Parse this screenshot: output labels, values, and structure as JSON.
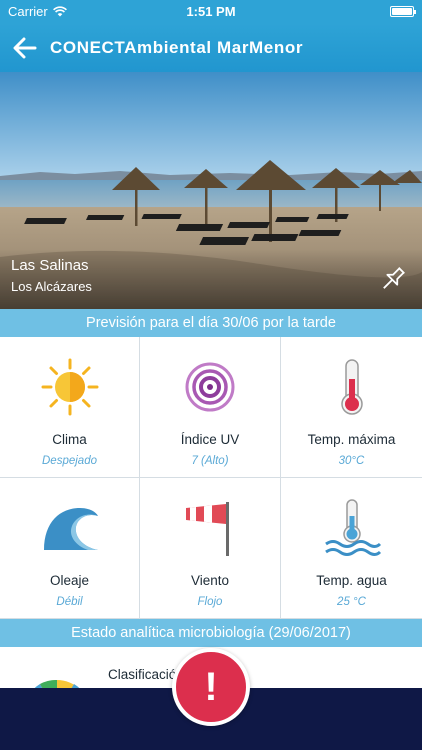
{
  "status_bar": {
    "carrier": "Carrier",
    "time": "1:51 PM"
  },
  "nav": {
    "title": "CONECTAmbiental MarMenor",
    "back_icon": "arrow-left-icon"
  },
  "hero": {
    "place_name": "Las Salinas",
    "town": "Los Alcázares",
    "pin_icon": "pin-icon"
  },
  "forecast": {
    "header": "Previsión para el día 30/06 por la tarde",
    "items": [
      {
        "label": "Clima",
        "value": "Despejado",
        "icon": "sun-icon"
      },
      {
        "label": "Índice UV",
        "value": "7 (Alto)",
        "icon": "uv-index-icon"
      },
      {
        "label": "Temp. máxima",
        "value": "30°C",
        "icon": "thermometer-icon"
      },
      {
        "label": "Oleaje",
        "value": "Débil",
        "icon": "wave-icon"
      },
      {
        "label": "Viento",
        "value": "Flojo",
        "icon": "windsock-icon"
      },
      {
        "label": "Temp. agua",
        "value": "25 °C",
        "icon": "water-thermometer-icon"
      }
    ]
  },
  "microbiology": {
    "header": "Estado analítica microbiología (29/06/2017)",
    "classification_label": "Clasificación",
    "icon": "beach-umbrella-icon"
  },
  "alert": {
    "label": "!",
    "icon": "alert-icon"
  },
  "colors": {
    "accent": "#2ea3d6",
    "band": "#6fc0e4",
    "footer": "#0f1846",
    "alert": "#dc2f4d",
    "value_text": "#5aa9d6"
  }
}
